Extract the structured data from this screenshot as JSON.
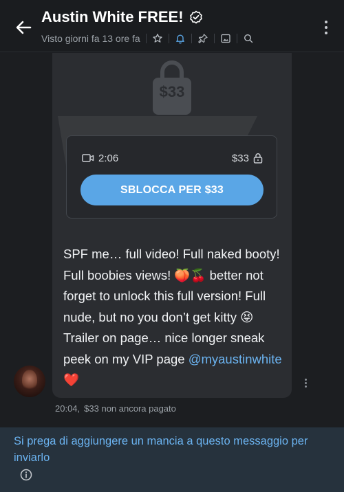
{
  "header": {
    "title": "Austin White FREE!",
    "status": "Visto giorni fa 13 ore fa",
    "icons": [
      "back-arrow-icon",
      "verified-icon",
      "star-icon",
      "bell-icon",
      "pin-icon",
      "gallery-icon",
      "search-icon",
      "more-vertical-icon"
    ]
  },
  "message": {
    "locked_price": "$33",
    "media": {
      "duration": "2:06",
      "price": "$33"
    },
    "unlock_label": "SBLOCCA PER $33",
    "text_before_mention": "SPF me… full video! Full naked booty! Full boobies views! 🍑🍒 better not forget to unlock this full version! Full nude, but no you don’t get kitty 😝 Trailer on page… nice longer sneak peek on my VIP page ",
    "mention": "@myaustinwhite",
    "text_after_mention": " ❤️",
    "time": "20:04,",
    "payment_status": "$33 non ancora pagato"
  },
  "footer": {
    "notice": "Si prega di aggiungere un mancia a questo messaggio per inviarlo"
  },
  "colors": {
    "accent": "#5aa6e6",
    "link": "#6bb3f0",
    "background": "#1c1e21",
    "bubble": "#2b2d31",
    "footer_bg": "#26323d"
  }
}
